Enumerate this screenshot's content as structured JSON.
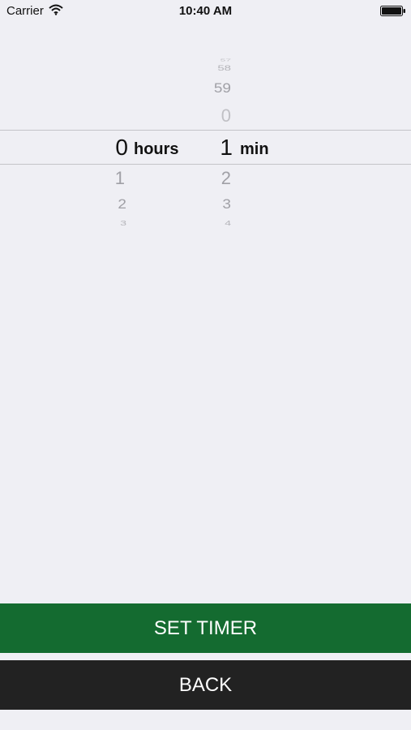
{
  "status_bar": {
    "carrier": "Carrier",
    "time": "10:40 AM"
  },
  "picker": {
    "hours": {
      "unit": "hours",
      "selected": "0",
      "below": [
        "1",
        "2",
        "3"
      ]
    },
    "minutes": {
      "unit": "min",
      "above": [
        "57",
        "58",
        "59",
        "0"
      ],
      "selected": "1",
      "below": [
        "2",
        "3",
        "4"
      ]
    }
  },
  "buttons": {
    "set_timer": "SET TIMER",
    "back": "BACK"
  },
  "colors": {
    "background": "#efeff4",
    "set_timer_bg": "#146b30",
    "back_bg": "#222222"
  }
}
